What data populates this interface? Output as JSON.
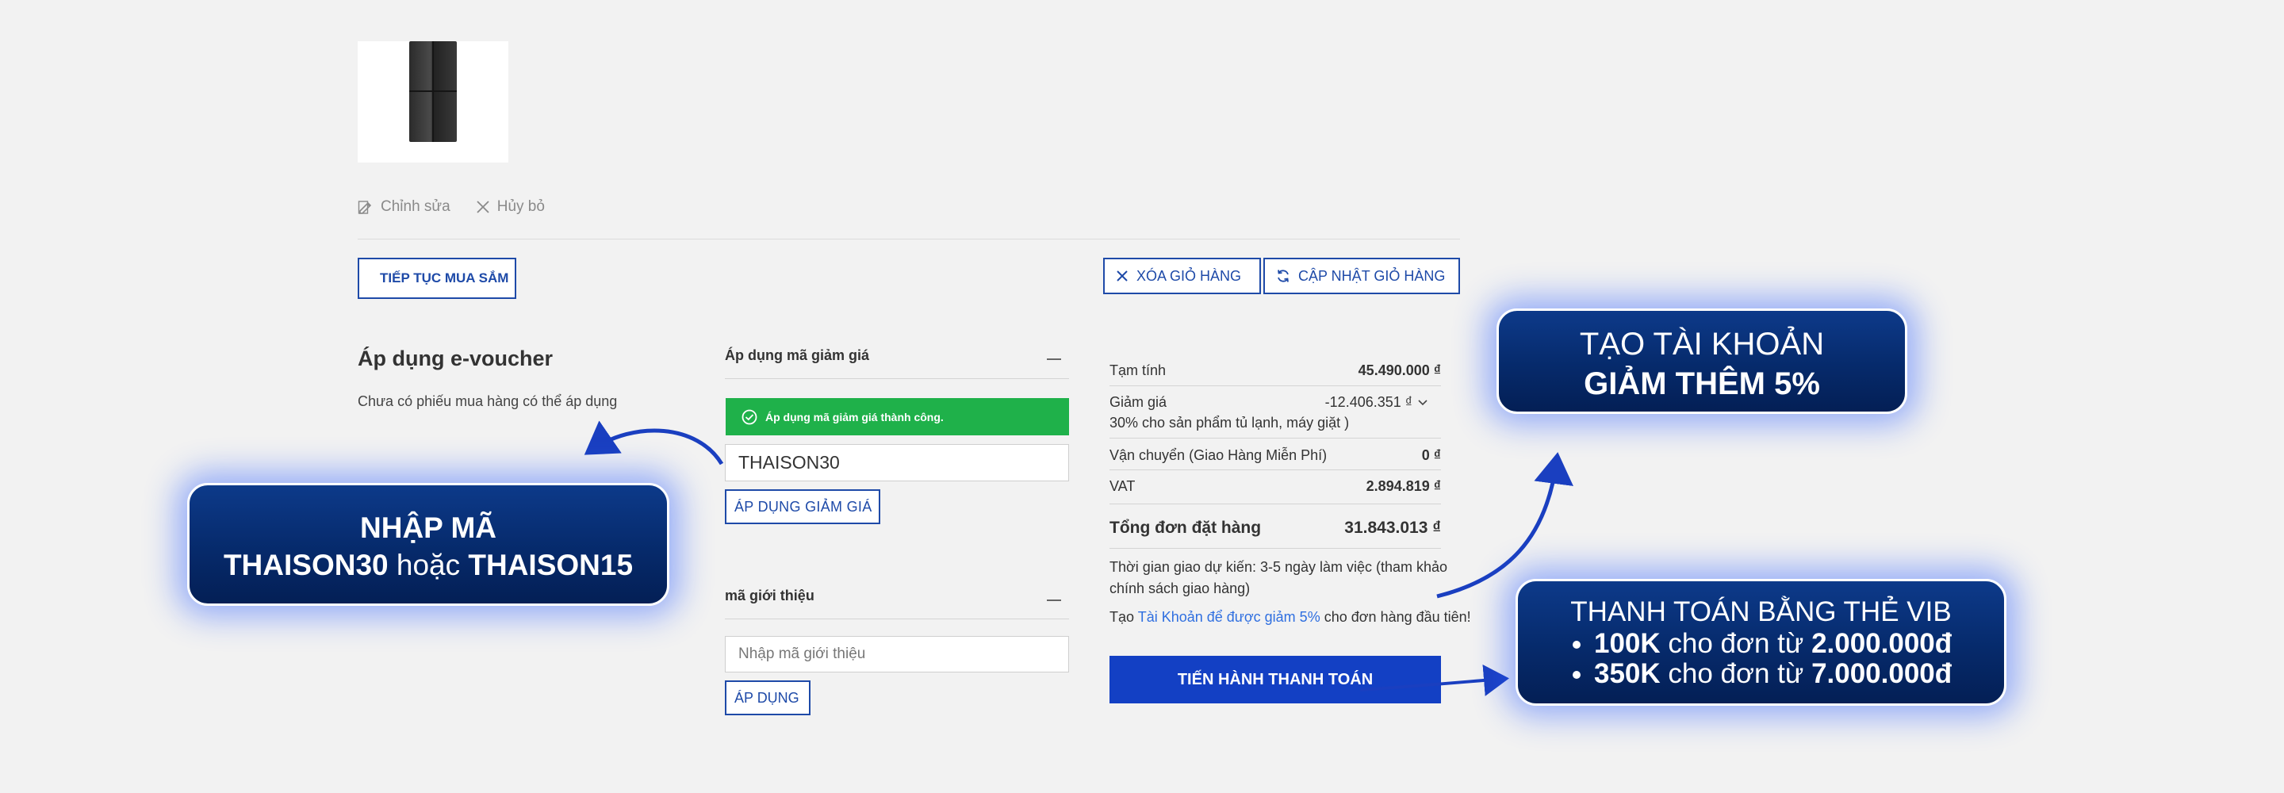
{
  "cart_item": {
    "edit_label": "Chỉnh sửa",
    "cancel_label": "Hủy bỏ"
  },
  "actions": {
    "continue_shopping": "TIẾP TỤC MUA SẮM",
    "clear_cart": "XÓA GIỎ HÀNG",
    "update_cart": "CẬP NHẬT GIỎ HÀNG"
  },
  "evoucher": {
    "title": "Áp dụng e-voucher",
    "subtitle": "Chưa có phiếu mua hàng có thể áp dụng"
  },
  "coupon": {
    "title": "Áp dụng mã giảm giá",
    "success_message": "Áp dụng mã giảm giá thành công.",
    "value": "THAISON30",
    "apply_label": "ÁP DỤNG GIẢM GIÁ"
  },
  "referral": {
    "title": "mã giới thiệu",
    "placeholder": "Nhập mã giới thiệu",
    "apply_label": "ÁP DỤNG"
  },
  "summary": {
    "subtotal_label": "Tạm tính",
    "subtotal_value": "45.490.000 ₫",
    "discount_label": "Giảm giá",
    "discount_value": "-12.406.351 ₫",
    "discount_detail": "30% cho sản phẩm tủ lạnh, máy giặt )",
    "shipping_label": "Vận chuyển (Giao Hàng Miễn Phí)",
    "shipping_value": "0 ₫",
    "vat_label": "VAT",
    "vat_value": "2.894.819 ₫",
    "total_label": "Tổng đơn đặt hàng",
    "total_value": "31.843.013 ₫",
    "delivery_note": "Thời gian giao dự kiến: 3-5 ngày làm việc (tham khảo chính sách giao hàng)",
    "promo_prefix": "Tạo",
    "promo_link": "Tài Khoản để được giảm 5%",
    "promo_suffix": "cho đơn hàng đầu tiên!",
    "checkout_label": "TIẾN HÀNH THANH TOÁN"
  },
  "callouts": {
    "code_line1": "NHẬP MÃ",
    "code_a": "THAISON30",
    "code_or": "hoặc",
    "code_b": "THAISON15",
    "account_line1": "TẠO TÀI KHOẢN",
    "account_line2": "GIẢM THÊM 5%",
    "vib_title": "THANH TOÁN BẰNG THẺ VIB",
    "vib_items": [
      {
        "amount": "100K",
        "text": "cho đơn từ",
        "min": "2.000.000đ"
      },
      {
        "amount": "350K",
        "text": "cho đơn từ",
        "min": "7.000.000đ"
      }
    ]
  },
  "colors": {
    "brand_blue": "#1e4aa8",
    "checkout_blue": "#1340c4",
    "success_green": "#1fb14a",
    "callout_navy": "#062a6b",
    "link_blue": "#2f6fe0"
  }
}
